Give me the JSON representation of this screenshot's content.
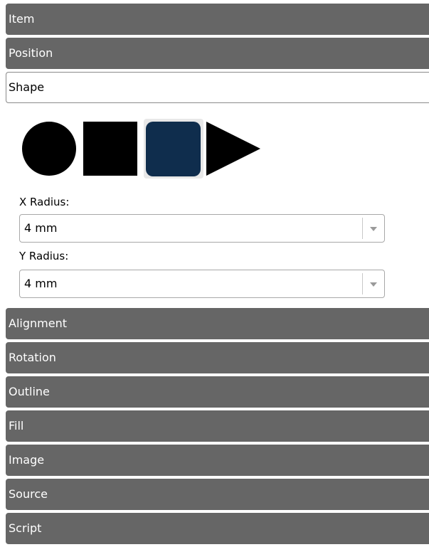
{
  "sections": {
    "item": "Item",
    "position": "Position",
    "shape": "Shape",
    "alignment": "Alignment",
    "rotation": "Rotation",
    "outline": "Outline",
    "fill": "Fill",
    "image": "Image",
    "source": "Source",
    "script": "Script"
  },
  "shape_panel": {
    "shapes": [
      {
        "icon": "circle-shape-icon",
        "selected": false
      },
      {
        "icon": "square-shape-icon",
        "selected": false
      },
      {
        "icon": "rounded-rectangle-shape-icon",
        "selected": true
      },
      {
        "icon": "triangle-shape-icon",
        "selected": false
      }
    ],
    "x_radius_label": "X Radius:",
    "x_radius_value": "4 mm",
    "y_radius_label": "Y Radius:",
    "y_radius_value": "4 mm"
  },
  "colors": {
    "header_bg": "#666666",
    "header_text": "#ffffff",
    "selected_shape_fill": "#0f2d4d",
    "shape_fill": "#000000"
  }
}
